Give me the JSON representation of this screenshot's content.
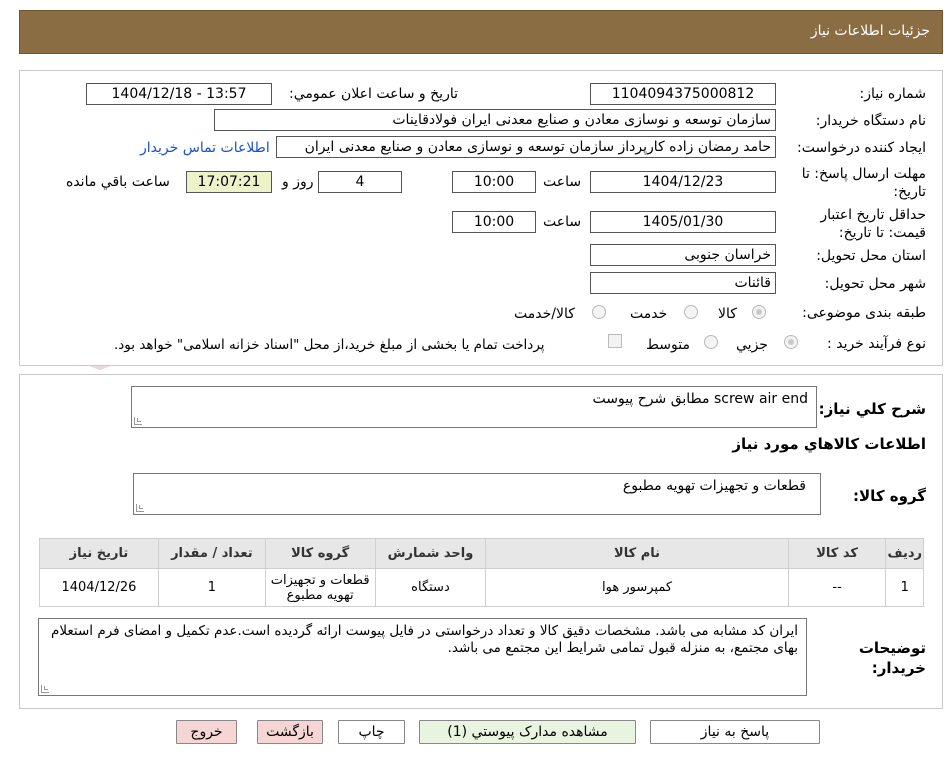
{
  "header": {
    "title": "جزئیات اطلاعات نیاز"
  },
  "watermark": {
    "text": "AriaTender.neT"
  },
  "form": {
    "need_number": {
      "label": "شماره نیاز:",
      "value": "1104094375000812"
    },
    "announce_datetime": {
      "label": "تاریخ و ساعت اعلان عمومي:",
      "value": "1404/12/18 - 13:57"
    },
    "buyer_org": {
      "label": "نام دستگاه خریدار:",
      "value": "سازمان توسعه و نوسازی معادن و صنایع معدنی ایران فولادقاینات"
    },
    "requester": {
      "label": "ایجاد کننده درخواست:",
      "value": "حامد  رمضان زاده  کارپرداز  سازمان توسعه و نوسازی معادن و صنایع معدنی ایران",
      "contact_link": "اطلاعات تماس خریدار"
    },
    "reply_deadline": {
      "label": "مهلت ارسال پاسخ: تا تاریخ:",
      "date": "1404/12/23",
      "time_label": "ساعت",
      "time": "10:00",
      "days": "4",
      "days_label": "روز و",
      "remaining": "17:07:21",
      "remaining_label": "ساعت باقي مانده"
    },
    "price_validity": {
      "label": "حداقل تاریخ اعتبار قیمت: تا تاریخ:",
      "date": "1405/01/30",
      "time_label": "ساعت",
      "time": "10:00"
    },
    "delivery_province": {
      "label": "استان محل تحویل:",
      "value": "خراسان جنوبی"
    },
    "delivery_city": {
      "label": "شهر محل تحویل:",
      "value": "قائنات"
    },
    "category": {
      "label": "طبقه بندی موضوعی:",
      "options": [
        "کالا",
        "خدمت",
        "کالا/خدمت"
      ],
      "selected": "کالا"
    },
    "purchase_type": {
      "label": "نوع فرآیند خرید :",
      "options": [
        "جزیي",
        "متوسط"
      ],
      "selected": "جزیي",
      "treasury_note": "پرداخت تمام یا بخشی از مبلغ خرید،از محل \"اسناد خزانه اسلامی\" خواهد بود."
    }
  },
  "summary": {
    "label": "شرح کلي نیاز:",
    "value": "screw air end مطابق شرح پیوست",
    "items_heading": "اطلاعات کالاهاي مورد نیاز",
    "group_label": "گروه کالا:",
    "group_value": "قطعات و تجهیزات تهویه مطبوع"
  },
  "table": {
    "headers": [
      "ردیف",
      "کد کالا",
      "نام کالا",
      "واحد شمارش",
      "گروه کالا",
      "تعداد / مقدار",
      "تاریخ نیاز"
    ],
    "rows": [
      [
        "1",
        "--",
        "کمپرسور هوا",
        "دستگاه",
        "قطعات و تجهیزات تهویه مطبوع",
        "1",
        "1404/12/26"
      ]
    ]
  },
  "notes": {
    "label": "توضیحات خریدار:",
    "value": "ایران کد مشابه می باشد. مشخصات دقیق کالا و تعداد درخواستی در فایل پیوست ارائه گردیده است.عدم تکمیل و امضای فرم استعلام بهای مجتمع، به منزله قبول تمامی شرایط این مجتمع می باشد."
  },
  "buttons": {
    "reply": "پاسخ به نیاز",
    "attachments": "مشاهده مدارک پیوستي (1)",
    "print": "چاپ",
    "back": "بازگشت",
    "exit": "خروج"
  },
  "colors": {
    "header_bg": "#8b6d43",
    "link": "#1a4fd6",
    "button_green": "#e8f4df",
    "button_pink": "#f6d5d5",
    "remaining_bg": "#eef2c8"
  }
}
